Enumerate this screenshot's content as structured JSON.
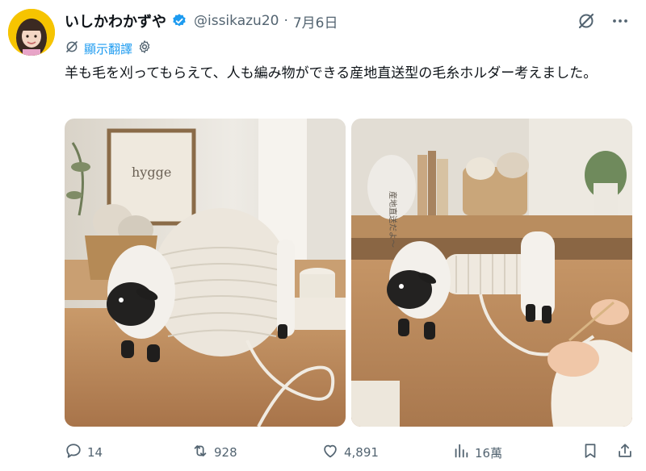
{
  "author": {
    "name": "いしかわかずや",
    "handle": "@issikazu20",
    "separator": "·",
    "date": "7月6日",
    "verified_icon": "verified-badge-icon",
    "accent": "#1d9bf0"
  },
  "translate": {
    "label": "顯示翻譯"
  },
  "tweet": {
    "text": "羊も毛を刈ってもらえて、人も編み物ができる産地直送型の毛糸ホルダー考えました。"
  },
  "media": [
    {
      "icon": "sheep-yarn-holder-photo",
      "sign_text": "hygge"
    },
    {
      "icon": "sheep-yarn-holder-knitting-photo",
      "overlay_text": "産地直送だよ〜"
    }
  ],
  "actions": {
    "reply_count": "14",
    "retweet_count": "928",
    "like_count": "4,891",
    "view_count": "16萬"
  }
}
